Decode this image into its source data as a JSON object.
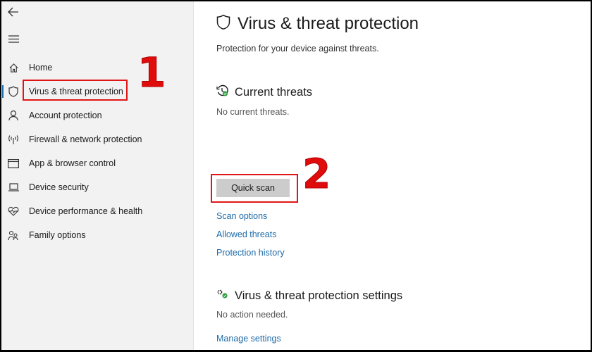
{
  "sidebar": {
    "back_icon": "back-arrow-icon",
    "menu_icon": "hamburger-menu-icon",
    "items": [
      {
        "label": "Home",
        "icon": "home-icon",
        "active": false
      },
      {
        "label": "Virus & threat protection",
        "icon": "shield-icon",
        "active": true
      },
      {
        "label": "Account protection",
        "icon": "person-icon",
        "active": false
      },
      {
        "label": "Firewall & network protection",
        "icon": "wifi-antenna-icon",
        "active": false
      },
      {
        "label": "App & browser control",
        "icon": "browser-window-icon",
        "active": false
      },
      {
        "label": "Device security",
        "icon": "laptop-icon",
        "active": false
      },
      {
        "label": "Device performance & health",
        "icon": "heart-pulse-icon",
        "active": false
      },
      {
        "label": "Family options",
        "icon": "family-icon",
        "active": false
      }
    ]
  },
  "annotations": {
    "step1": "1",
    "step2": "2",
    "highlight_color": "#e01616"
  },
  "main": {
    "title": "Virus & threat protection",
    "subtitle": "Protection for your device against threats.",
    "current_threats": {
      "heading": "Current threats",
      "status": "No current threats.",
      "quick_scan_label": "Quick scan",
      "links": [
        "Scan options",
        "Allowed threats",
        "Protection history"
      ]
    },
    "settings": {
      "heading": "Virus & threat protection settings",
      "status": "No action needed.",
      "link": "Manage settings"
    }
  },
  "colors": {
    "link": "#1d6aa8",
    "active_indicator": "#1e6fb0",
    "status_green": "#2e9e3e"
  }
}
